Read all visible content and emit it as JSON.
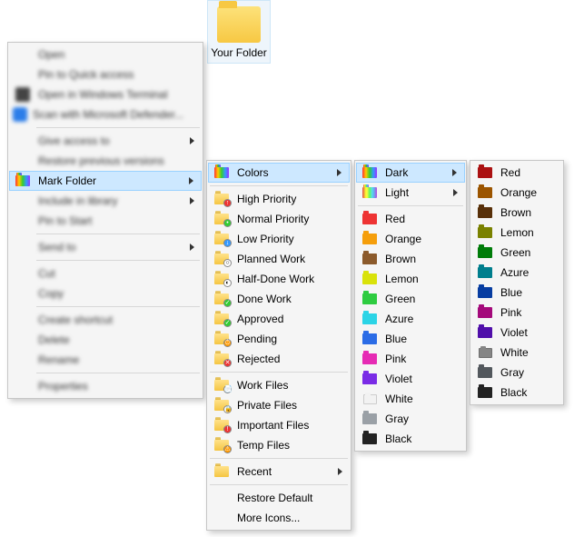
{
  "folder": {
    "name": "Your Folder"
  },
  "context_menu": {
    "open": "Open",
    "pin_quick_access": "Pin to Quick access",
    "open_terminal": "Open in Windows Terminal",
    "scan_defender": "Scan with Microsoft Defender...",
    "give_access": "Give access to",
    "restore_versions": "Restore previous versions",
    "mark_folder": "Mark Folder",
    "include_library": "Include in library",
    "pin_start": "Pin to Start",
    "send_to": "Send to",
    "cut": "Cut",
    "copy": "Copy",
    "create_shortcut": "Create shortcut",
    "delete": "Delete",
    "rename": "Rename",
    "properties": "Properties"
  },
  "mark_menu": {
    "colors": "Colors",
    "high_priority": "High Priority",
    "normal_priority": "Normal Priority",
    "low_priority": "Low Priority",
    "planned_work": "Planned Work",
    "half_done": "Half-Done Work",
    "done_work": "Done Work",
    "approved": "Approved",
    "pending": "Pending",
    "rejected": "Rejected",
    "work_files": "Work Files",
    "private_files": "Private Files",
    "important_files": "Important Files",
    "temp_files": "Temp Files",
    "recent": "Recent",
    "restore_default": "Restore Default",
    "more_icons": "More Icons..."
  },
  "colors_menu": {
    "dark": "Dark",
    "light": "Light",
    "red": "Red",
    "orange": "Orange",
    "brown": "Brown",
    "lemon": "Lemon",
    "green": "Green",
    "azure": "Azure",
    "blue": "Blue",
    "pink": "Pink",
    "violet": "Violet",
    "white": "White",
    "gray": "Gray",
    "black": "Black"
  },
  "dark_menu": {
    "red": "Red",
    "orange": "Orange",
    "brown": "Brown",
    "lemon": "Lemon",
    "green": "Green",
    "azure": "Azure",
    "blue": "Blue",
    "pink": "Pink",
    "violet": "Violet",
    "white": "White",
    "gray": "Gray",
    "black": "Black"
  }
}
